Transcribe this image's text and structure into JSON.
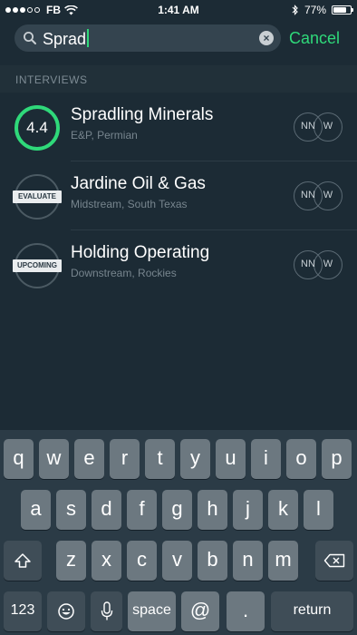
{
  "status_bar": {
    "carrier": "FB",
    "time": "1:41 AM",
    "battery": "77%",
    "battery_level": 0.77,
    "signal_dots_filled": 3,
    "signal_dots_total": 5
  },
  "search": {
    "query": "Sprad",
    "cancel_label": "Cancel"
  },
  "section": {
    "title": "INTERVIEWS"
  },
  "results": [
    {
      "company": "Spradling Minerals",
      "meta": "E&P, Permian",
      "score": "4.4",
      "status": "",
      "avatars": [
        "NN",
        "W"
      ]
    },
    {
      "company": "Jardine Oil & Gas",
      "meta": "Midstream, South Texas",
      "score": "",
      "status": "EVALUATE",
      "avatars": [
        "NN",
        "W"
      ]
    },
    {
      "company": "Holding Operating",
      "meta": "Downstream, Rockies",
      "score": "",
      "status": "UPCOMING",
      "avatars": [
        "NN",
        "W"
      ]
    }
  ],
  "keyboard": {
    "row1": [
      "q",
      "w",
      "e",
      "r",
      "t",
      "y",
      "u",
      "i",
      "o",
      "p"
    ],
    "row2": [
      "a",
      "s",
      "d",
      "f",
      "g",
      "h",
      "j",
      "k",
      "l"
    ],
    "row3": [
      "z",
      "x",
      "c",
      "v",
      "b",
      "n",
      "m"
    ],
    "numbers_label": "123",
    "space_label": "space",
    "at_label": "@",
    "period_label": ".",
    "return_label": "return"
  },
  "colors": {
    "accent": "#2fd97a",
    "background": "#1c2b35",
    "keyboard_bg": "#2b3b46"
  }
}
